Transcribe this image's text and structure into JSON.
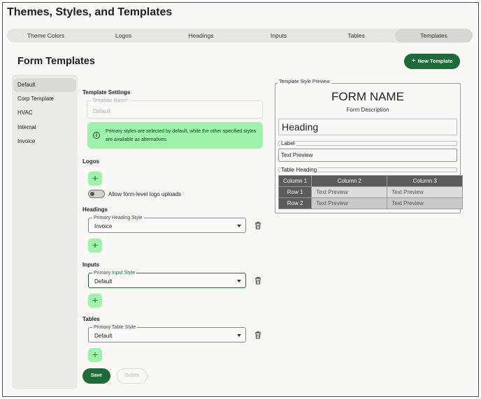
{
  "app": {
    "title": "Themes, Styles, and Templates"
  },
  "tabs": [
    {
      "label": "Theme Colors"
    },
    {
      "label": "Logos"
    },
    {
      "label": "Headings"
    },
    {
      "label": "Inputs"
    },
    {
      "label": "Tables"
    },
    {
      "label": "Templates",
      "active": true
    }
  ],
  "page": {
    "title": "Form Templates",
    "new_button": "New Template"
  },
  "sidebar": {
    "items": [
      {
        "label": "Default",
        "active": true
      },
      {
        "label": "Corp Template"
      },
      {
        "label": "HVAC"
      },
      {
        "label": "Internal"
      },
      {
        "label": "Invoice"
      }
    ]
  },
  "settings": {
    "heading": "Template Settings",
    "name_label": "Template Name*",
    "name_placeholder": "Default",
    "info_text": "Primary styles are selected by default, while the other specified styles are available as alternatives.",
    "logos": {
      "heading": "Logos",
      "toggle_label": "Allow form-level logo uploads",
      "toggle_on": false
    },
    "headings": {
      "heading": "Headings",
      "field_label": "Primary Heading Style",
      "value": "Invoice"
    },
    "inputs": {
      "heading": "Inputs",
      "field_label": "Primary Input Style",
      "value": "Default"
    },
    "tables": {
      "heading": "Tables",
      "field_label": "Primary Table Style",
      "value": "Default"
    },
    "add_symbol": "+",
    "save": "Save",
    "delete": "Delete"
  },
  "preview": {
    "label": "Template Style Preview",
    "form_name": "FORM NAME",
    "form_description": "Form Description",
    "heading": "Heading",
    "input_label": "Label",
    "input_text": "Text Preview",
    "table_heading": "Table Heading",
    "table": {
      "headers": [
        "Column 1",
        "Column 2",
        "Column 3"
      ],
      "rows": [
        [
          "Row 1",
          "Text Preview",
          "Text Preview"
        ],
        [
          "Row 2",
          "Text Preview",
          "Text Preview"
        ]
      ]
    }
  },
  "colors": {
    "accent": "#1e6b3a",
    "accent_light": "#9ef3ab",
    "table_header": "#5b5b5b"
  },
  "icons": [
    "plus-icon",
    "info-icon",
    "trash-icon",
    "chevron-down-icon"
  ]
}
